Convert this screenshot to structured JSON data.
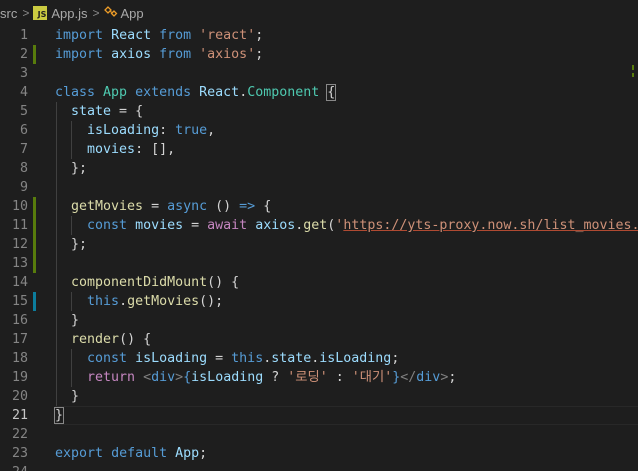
{
  "breadcrumb": {
    "folder": "src",
    "file": "App.js",
    "file_icon_text": "JS",
    "symbol": "App",
    "separator": ">"
  },
  "editor": {
    "current_line": 21,
    "lines": [
      {
        "n": "1",
        "tokens": [
          [
            "kw",
            "import"
          ],
          [
            "pun",
            " "
          ],
          [
            "var",
            "React"
          ],
          [
            "pun",
            " "
          ],
          [
            "kw",
            "from"
          ],
          [
            "pun",
            " "
          ],
          [
            "str",
            "'react'"
          ],
          [
            "pun",
            ";"
          ]
        ]
      },
      {
        "n": "2",
        "tokens": [
          [
            "kw",
            "import"
          ],
          [
            "pun",
            " "
          ],
          [
            "var",
            "axios"
          ],
          [
            "pun",
            " "
          ],
          [
            "kw",
            "from"
          ],
          [
            "pun",
            " "
          ],
          [
            "str",
            "'axios'"
          ],
          [
            "pun",
            ";"
          ]
        ]
      },
      {
        "n": "3",
        "tokens": []
      },
      {
        "n": "4",
        "tokens": [
          [
            "kw",
            "class"
          ],
          [
            "pun",
            " "
          ],
          [
            "cls",
            "App"
          ],
          [
            "pun",
            " "
          ],
          [
            "kw",
            "extends"
          ],
          [
            "pun",
            " "
          ],
          [
            "var",
            "React"
          ],
          [
            "pun",
            "."
          ],
          [
            "cls",
            "Component"
          ],
          [
            "pun",
            " "
          ],
          [
            "pun",
            "{"
          ]
        ]
      },
      {
        "n": "5",
        "tokens": [
          [
            "pun",
            "  "
          ],
          [
            "var",
            "state"
          ],
          [
            "pun",
            " = {"
          ]
        ]
      },
      {
        "n": "6",
        "tokens": [
          [
            "pun",
            "    "
          ],
          [
            "var",
            "isLoading"
          ],
          [
            "pun",
            ": "
          ],
          [
            "kw",
            "true"
          ],
          [
            "pun",
            ","
          ]
        ]
      },
      {
        "n": "7",
        "tokens": [
          [
            "pun",
            "    "
          ],
          [
            "var",
            "movies"
          ],
          [
            "pun",
            ": [],"
          ]
        ]
      },
      {
        "n": "8",
        "tokens": [
          [
            "pun",
            "  };"
          ]
        ]
      },
      {
        "n": "9",
        "tokens": []
      },
      {
        "n": "10",
        "tokens": [
          [
            "pun",
            "  "
          ],
          [
            "fn",
            "getMovies"
          ],
          [
            "pun",
            " = "
          ],
          [
            "kw",
            "async"
          ],
          [
            "pun",
            " () "
          ],
          [
            "kw",
            "=>"
          ],
          [
            "pun",
            " {"
          ]
        ]
      },
      {
        "n": "11",
        "tokens": [
          [
            "pun",
            "    "
          ],
          [
            "kw",
            "const"
          ],
          [
            "pun",
            " "
          ],
          [
            "var",
            "movies"
          ],
          [
            "pun",
            " = "
          ],
          [
            "ctl",
            "await"
          ],
          [
            "pun",
            " "
          ],
          [
            "var",
            "axios"
          ],
          [
            "pun",
            "."
          ],
          [
            "fn",
            "get"
          ],
          [
            "pun",
            "("
          ],
          [
            "str",
            "'"
          ],
          [
            "url",
            "https://yts-proxy.now.sh/list_movies.js"
          ]
        ]
      },
      {
        "n": "12",
        "tokens": [
          [
            "pun",
            "  };"
          ]
        ]
      },
      {
        "n": "13",
        "tokens": []
      },
      {
        "n": "14",
        "tokens": [
          [
            "pun",
            "  "
          ],
          [
            "fn",
            "componentDidMount"
          ],
          [
            "pun",
            "() {"
          ]
        ]
      },
      {
        "n": "15",
        "tokens": [
          [
            "pun",
            "    "
          ],
          [
            "kw",
            "this"
          ],
          [
            "pun",
            "."
          ],
          [
            "fn",
            "getMovies"
          ],
          [
            "pun",
            "();"
          ]
        ]
      },
      {
        "n": "16",
        "tokens": [
          [
            "pun",
            "  }"
          ]
        ]
      },
      {
        "n": "17",
        "tokens": [
          [
            "pun",
            "  "
          ],
          [
            "fn",
            "render"
          ],
          [
            "pun",
            "() {"
          ]
        ]
      },
      {
        "n": "18",
        "tokens": [
          [
            "pun",
            "    "
          ],
          [
            "kw",
            "const"
          ],
          [
            "pun",
            " "
          ],
          [
            "var",
            "isLoading"
          ],
          [
            "pun",
            " = "
          ],
          [
            "kw",
            "this"
          ],
          [
            "pun",
            "."
          ],
          [
            "var",
            "state"
          ],
          [
            "pun",
            "."
          ],
          [
            "var",
            "isLoading"
          ],
          [
            "pun",
            ";"
          ]
        ]
      },
      {
        "n": "19",
        "tokens": [
          [
            "pun",
            "    "
          ],
          [
            "ctl",
            "return"
          ],
          [
            "pun",
            " "
          ],
          [
            "tag",
            "<"
          ],
          [
            "kw",
            "div"
          ],
          [
            "tag",
            ">"
          ],
          [
            "kw",
            "{"
          ],
          [
            "var",
            "isLoading"
          ],
          [
            "pun",
            " ? "
          ],
          [
            "str",
            "'로딩'"
          ],
          [
            "pun",
            " : "
          ],
          [
            "str",
            "'대기'"
          ],
          [
            "kw",
            "}"
          ],
          [
            "tag",
            "</"
          ],
          [
            "kw",
            "div"
          ],
          [
            "tag",
            ">"
          ],
          [
            "pun",
            ";"
          ]
        ]
      },
      {
        "n": "20",
        "tokens": [
          [
            "pun",
            "  }"
          ]
        ]
      },
      {
        "n": "21",
        "tokens": [
          [
            "pun",
            "}"
          ]
        ]
      },
      {
        "n": "22",
        "tokens": []
      },
      {
        "n": "23",
        "tokens": [
          [
            "kw",
            "export"
          ],
          [
            "pun",
            " "
          ],
          [
            "kw",
            "default"
          ],
          [
            "pun",
            " "
          ],
          [
            "var",
            "App"
          ],
          [
            "pun",
            ";"
          ]
        ]
      },
      {
        "n": "24",
        "tokens": []
      }
    ],
    "gutter": [
      {
        "line": 2,
        "kind": "added"
      },
      {
        "line": 10,
        "kind": "added"
      },
      {
        "line": 11,
        "kind": "added"
      },
      {
        "line": 12,
        "kind": "added"
      },
      {
        "line": 13,
        "kind": "added"
      },
      {
        "line": 15,
        "kind": "modified"
      }
    ]
  },
  "colors": {
    "background": "#1e1e1e",
    "keyword": "#569cd6",
    "control": "#c586c0",
    "string": "#ce9178",
    "class": "#4ec9b0",
    "variable": "#9cdcfe",
    "function": "#dcdcaa",
    "added": "#587c0c",
    "modified": "#0c7d9d"
  }
}
